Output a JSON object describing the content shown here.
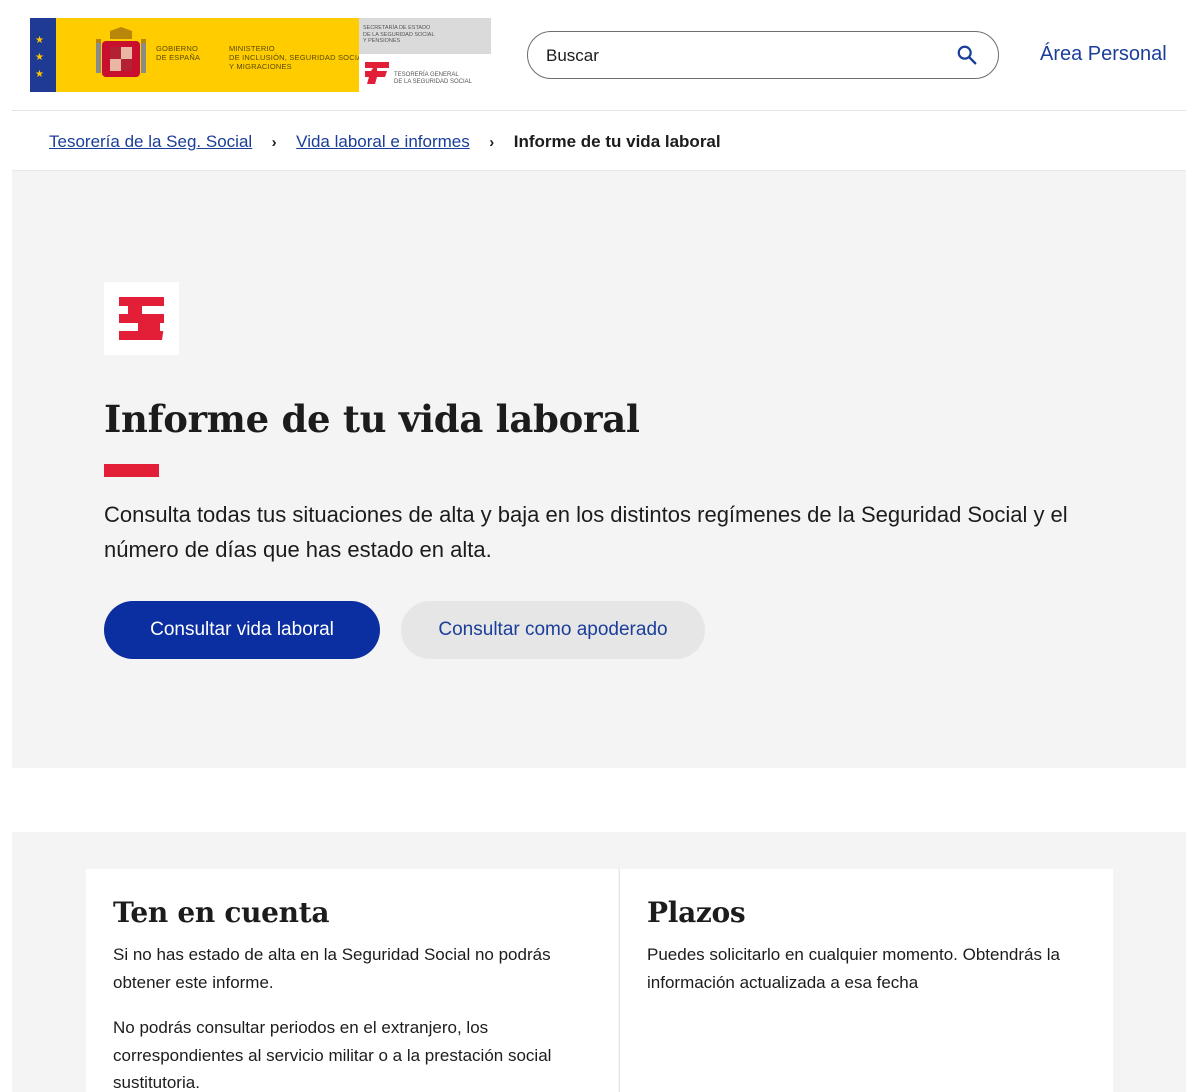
{
  "header": {
    "logo": {
      "gobierno": [
        "GOBIERNO",
        "DE ESPAÑA"
      ],
      "ministerio": [
        "MINISTERIO",
        "DE INCLUSIÓN, SEGURIDAD SOCIAL",
        "Y MIGRACIONES"
      ],
      "secretaria": [
        "SECRETARÍA DE ESTADO",
        "DE LA SEGURIDAD SOCIAL",
        "Y PENSIONES"
      ],
      "tesoreria": [
        "TESORERÍA GENERAL",
        "DE LA SEGURIDAD SOCIAL"
      ],
      "flag_colors": {
        "red": "#aa151b",
        "yellow": "#ffc400",
        "blue": "#1f3a93"
      }
    },
    "search": {
      "placeholder": "Buscar",
      "icon": "search-icon"
    },
    "area_personal": "Área Personal"
  },
  "breadcrumb": {
    "items": [
      "Tesorería de la Seg. Social",
      "Vida laboral e informes "
    ],
    "separator": "›",
    "current": "Informe de tu vida laboral"
  },
  "hero": {
    "title": "Informe de tu vida laboral",
    "description": "Consulta todas tus situaciones de alta y baja en los distintos regímenes de la Seguridad Social y el número de días que has estado en alta.",
    "primary_button": "Consultar vida laboral",
    "secondary_button": "Consultar como apoderado",
    "accent_color": "#e21f36",
    "primary_color": "#0b2ea0"
  },
  "info": {
    "ten_en_cuenta": {
      "title": "Ten en cuenta",
      "paragraphs": [
        "Si no has estado de alta en la Seguridad Social no podrás obtener este informe.",
        "No podrás consultar periodos en el extranjero, los correspondientes al servicio militar o a la prestación social sustitutoria."
      ]
    },
    "plazos": {
      "title": "Plazos",
      "text": "Puedes solicitarlo en cualquier momento. Obtendrás la información actualizada a esa fecha"
    }
  }
}
